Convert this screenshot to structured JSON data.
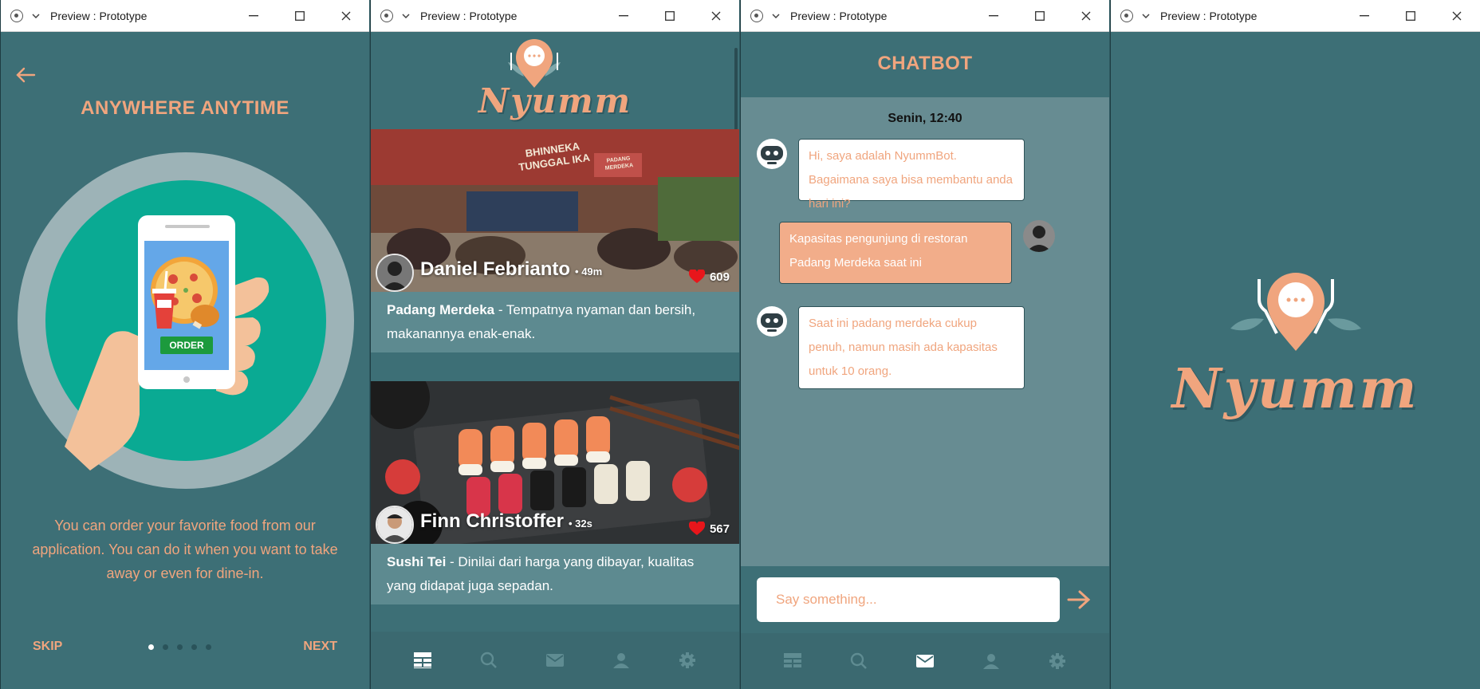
{
  "windows": [
    {
      "title": "Preview : Prototype"
    },
    {
      "title": "Preview : Prototype"
    },
    {
      "title": "Preview : Prototype"
    },
    {
      "title": "Preview : Prototype"
    }
  ],
  "onboarding": {
    "heading": "ANYWHERE ANYTIME",
    "order_label": "ORDER",
    "text": "You can order your favorite food from our application. You can do it when you want to take away or even for dine-in.",
    "skip": "SKIP",
    "next": "NEXT",
    "pages_total": 5,
    "page_current": 1
  },
  "brand": {
    "name": "Nyumm"
  },
  "feed": {
    "posts": [
      {
        "author": "Daniel Febrianto",
        "ago": "• 49m",
        "likes": "609",
        "place": "Padang Merdeka",
        "review": " - Tempatnya nyaman dan bersih, makanannya enak-enak.",
        "sign": "BHINNEKA TUNGGAL IKA",
        "sign2": "PADANG MERDEKA"
      },
      {
        "author": "Finn Christoffer",
        "ago": "• 32s",
        "likes": "567",
        "place": "Sushi Tei",
        "review": " - Dinilai dari harga yang dibayar, kualitas yang didapat juga sepadan."
      }
    ]
  },
  "chat": {
    "title": "CHATBOT",
    "time": "Senin, 12:40",
    "messages": [
      {
        "from": "bot",
        "text": "Hi, saya adalah NyummBot. Bagaimana saya bisa membantu anda hari ini?"
      },
      {
        "from": "user",
        "text": "Kapasitas pengunjung di restoran Padang Merdeka saat ini"
      },
      {
        "from": "bot",
        "text": "Saat ini padang merdeka cukup penuh, namun masih ada kapasitas untuk 10 orang."
      }
    ],
    "input_placeholder": "Say something..."
  },
  "nav_icons": [
    "feed-icon",
    "search-icon",
    "mail-icon",
    "profile-icon",
    "settings-icon"
  ],
  "colors": {
    "accent": "#f0a57e",
    "teal": "#3d6f76",
    "dark_teal": "#2f5a62"
  }
}
